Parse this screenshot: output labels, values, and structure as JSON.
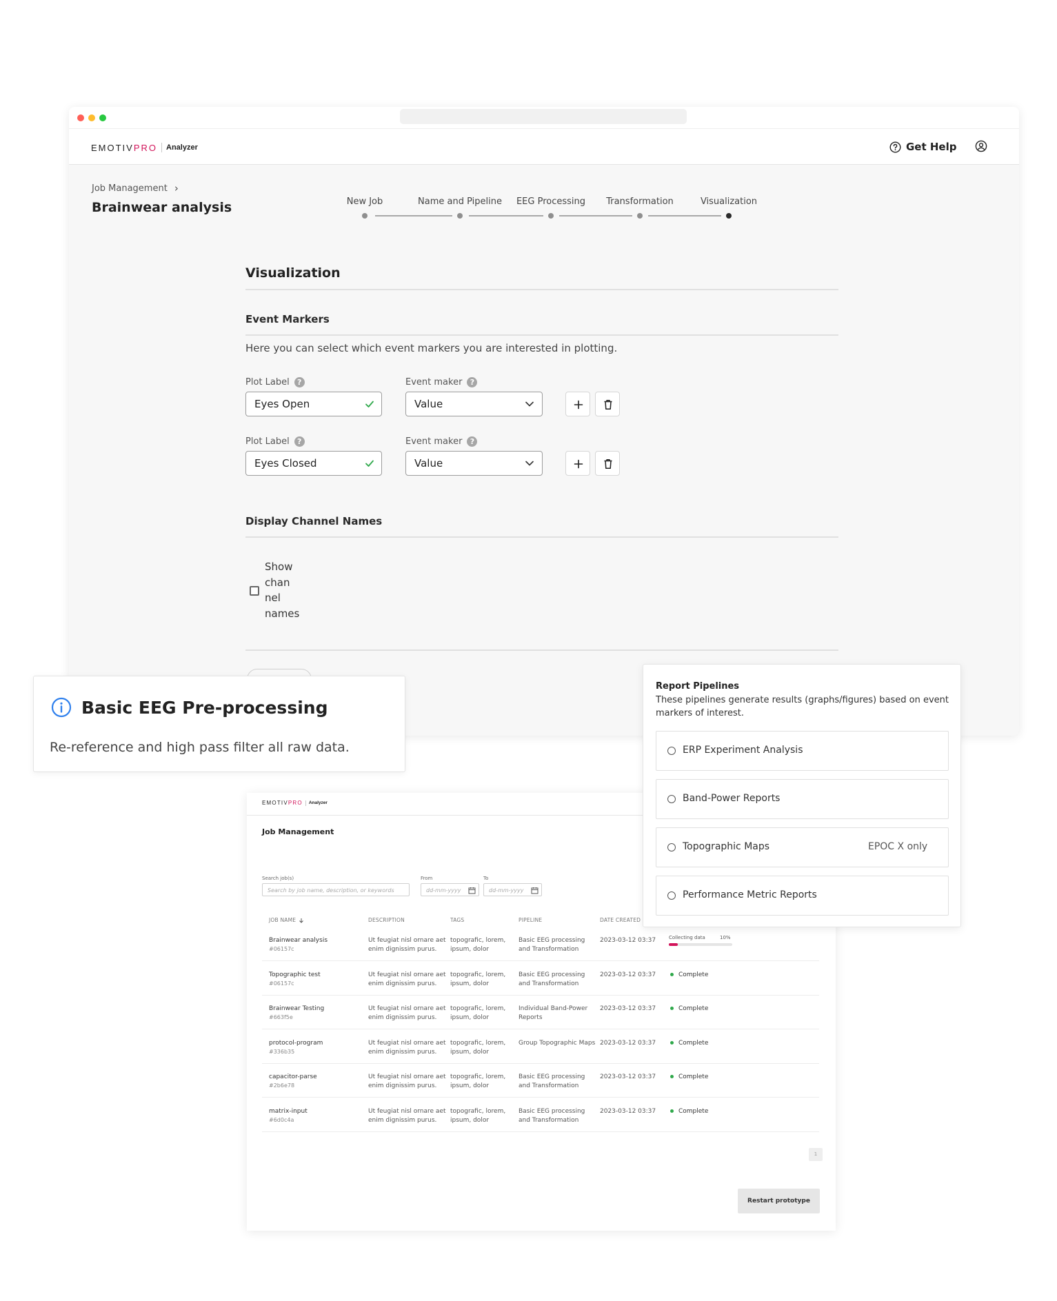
{
  "app": {
    "logo_main": "EMOTIV",
    "logo_pro": "PRO",
    "logo_sub": "Analyzer",
    "get_help": "Get Help"
  },
  "breadcrumb": {
    "parent": "Job Management",
    "separator": "›"
  },
  "page": {
    "title": "Brainwear analysis"
  },
  "stepper": {
    "steps": [
      {
        "label": "New Job"
      },
      {
        "label": "Name and Pipeline"
      },
      {
        "label": "EEG Processing"
      },
      {
        "label": "Transformation"
      },
      {
        "label": "Visualization"
      }
    ],
    "active_index": 4
  },
  "visualization": {
    "title": "Visualization",
    "event_markers": {
      "title": "Event Markers",
      "description": "Here you can select which event markers you are interested in plotting.",
      "rows": [
        {
          "plot_label_title": "Plot Label",
          "plot_label_value": "Eyes Open",
          "event_maker_title": "Event maker",
          "event_maker_value": "Value"
        },
        {
          "plot_label_title": "Plot Label",
          "plot_label_value": "Eyes Closed",
          "event_maker_title": "Event maker",
          "event_maker_value": "Value"
        }
      ]
    },
    "display_channels": {
      "title": "Display Channel Names",
      "checkbox_lines": [
        "Show",
        "chan",
        "nel",
        "names"
      ],
      "checked": false
    }
  },
  "info_card": {
    "title": "Basic EEG Pre-processing",
    "body": "Re-reference and high pass filter all raw data."
  },
  "report_pipelines": {
    "title": "Report Pipelines",
    "description_line1": "These pipelines generate results (graphs/figures) based on event",
    "description_line2": "markers of interest.",
    "options": [
      {
        "label": "ERP Experiment Analysis",
        "note": ""
      },
      {
        "label": "Band-Power Reports",
        "note": ""
      },
      {
        "label": "Topographic Maps",
        "note": "EPOC X only"
      },
      {
        "label": "Performance Metric Reports",
        "note": ""
      }
    ]
  },
  "job_management": {
    "title": "Job Management",
    "search_label": "Search job(s)",
    "search_placeholder": "Search by job name, description, or keywords",
    "from_label": "From",
    "to_label": "To",
    "date_placeholder": "dd-mm-yyyy",
    "columns": [
      "JOB NAME",
      "DESCRIPTION",
      "TAGS",
      "PIPELINE",
      "DATE CREATED"
    ],
    "rows": [
      {
        "name": "Brainwear analysis",
        "id": "#06157c",
        "desc1": "Ut feugiat nisl ornare aet",
        "desc2": "enim dignissim purus.",
        "tags1": "topografic, lorem,",
        "tags2": "ipsum, dolor",
        "pipe1": "Basic EEG processing",
        "pipe2": "and Transformation",
        "date": "2023-03-12 03:37",
        "status": "Collecting data",
        "progress_label": "10%",
        "progress": 0.1
      },
      {
        "name": "Topographic test",
        "id": "#06157c",
        "desc1": "Ut feugiat nisl ornare aet",
        "desc2": "enim dignissim purus.",
        "tags1": "topografic, lorem,",
        "tags2": "ipsum, dolor",
        "pipe1": "Basic EEG processing",
        "pipe2": "and Transformation",
        "date": "2023-03-12 03:37",
        "status": "Complete"
      },
      {
        "name": "Brainwear Testing",
        "id": "#663f5e",
        "desc1": "Ut feugiat nisl ornare aet",
        "desc2": "enim dignissim purus.",
        "tags1": "topografic, lorem,",
        "tags2": "ipsum, dolor",
        "pipe1": "Individual Band-Power",
        "pipe2": "Reports",
        "date": "2023-03-12 03:37",
        "status": "Complete"
      },
      {
        "name": "protocol-program",
        "id": "#336b35",
        "desc1": "Ut feugiat nisl ornare aet",
        "desc2": "enim dignissim purus.",
        "tags1": "topografic, lorem,",
        "tags2": "ipsum, dolor",
        "pipe1": "Group Topographic Maps",
        "pipe2": "",
        "date": "2023-03-12 03:37",
        "status": "Complete"
      },
      {
        "name": "capacitor-parse",
        "id": "#2b6e78",
        "desc1": "Ut feugiat nisl ornare aet",
        "desc2": "enim dignissim purus.",
        "tags1": "topografic, lorem,",
        "tags2": "ipsum, dolor",
        "pipe1": "Basic EEG processing",
        "pipe2": "and Transformation",
        "date": "2023-03-12 03:37",
        "status": "Complete"
      },
      {
        "name": "matrix-input",
        "id": "#6d0c4a",
        "desc1": "Ut feugiat nisl ornare aet",
        "desc2": "enim dignissim purus.",
        "tags1": "topografic, lorem,",
        "tags2": "ipsum, dolor",
        "pipe1": "Basic EEG processing",
        "pipe2": "and Transformation",
        "date": "2023-03-12 03:37",
        "status": "Complete"
      }
    ],
    "page_number": "1",
    "restart_button": "Restart prototype"
  },
  "colors": {
    "brand": "#d2145a",
    "success": "#2ea84a",
    "info": "#2f80ed",
    "window_close": "#ff5f57",
    "window_min": "#febc2e",
    "window_max": "#28c840"
  },
  "icons": {
    "help": "question-circle-icon",
    "account": "user-circle-icon",
    "valid": "check-icon",
    "dropdown": "chevron-down-icon",
    "add": "plus-icon",
    "delete": "trash-icon",
    "info": "info-circle-icon",
    "calendar": "calendar-icon",
    "sort": "arrow-down-icon"
  }
}
